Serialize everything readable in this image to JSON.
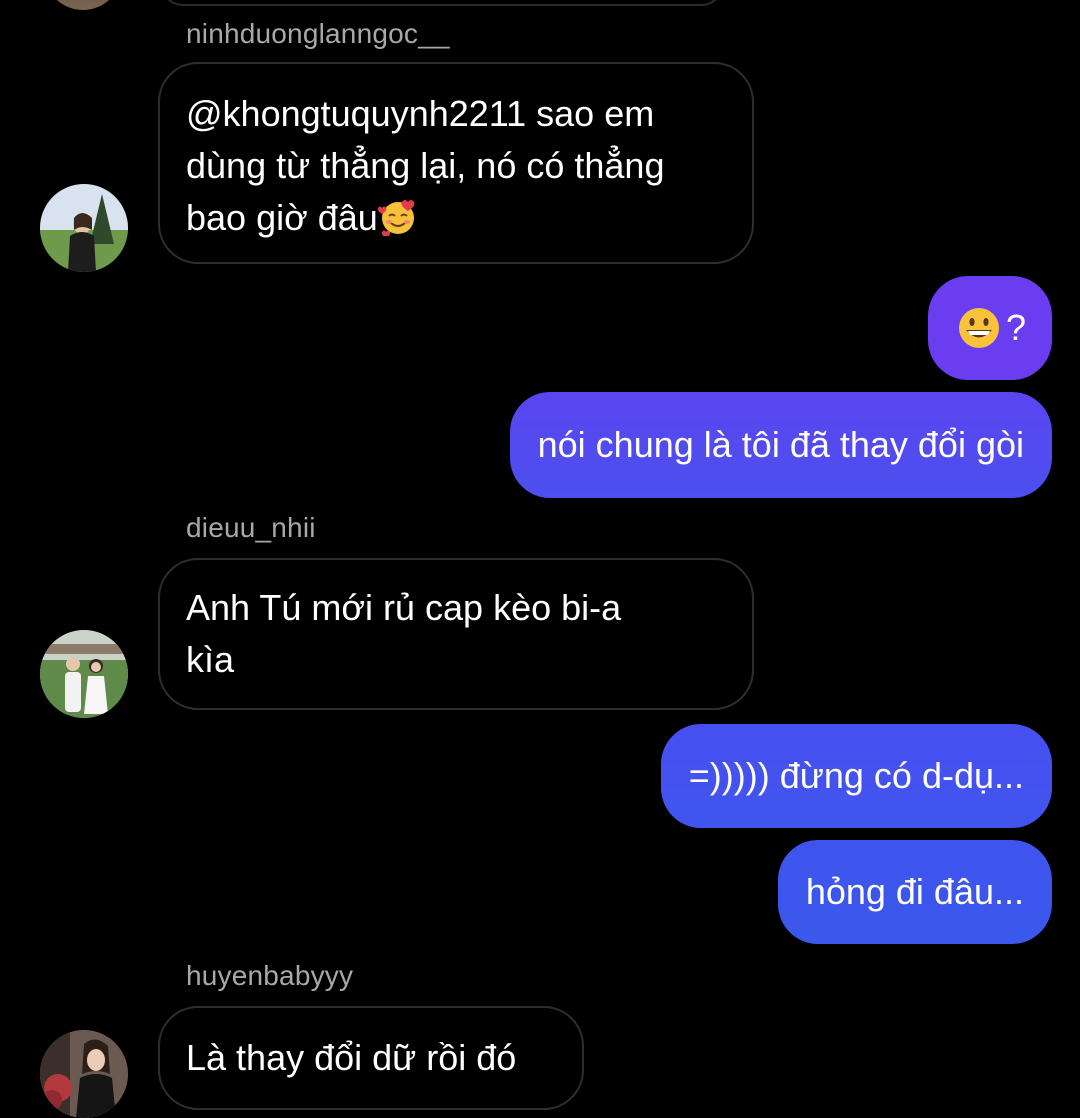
{
  "messages": [
    {
      "sender": "ninhduonglanngoc__",
      "text_line1": "@khongtuquynh2211 sao em",
      "text_line2": "dùng từ thẳng lại, nó có thẳng",
      "text_line3": "bao giờ đâu",
      "trailing_emoji": "smiling-face-with-hearts"
    },
    {
      "outgoing": true,
      "emoji": "grinning-face",
      "text": "?"
    },
    {
      "outgoing": true,
      "text": "nói chung là tôi đã thay đổi gòi"
    },
    {
      "sender": "dieuu_nhii",
      "text_line1": "Anh Tú mới rủ cap kèo bi-a",
      "text_line2": "kìa"
    },
    {
      "outgoing": true,
      "text": "=))))) đừng có d-dụ..."
    },
    {
      "outgoing": true,
      "text": "hỏng đi đâu..."
    },
    {
      "sender": "huyenbabyyy",
      "text_line1": "Là thay đổi dữ rồi đó"
    }
  ],
  "colors": {
    "background": "#000000",
    "incoming_border": "#2e2e2e",
    "sender_text": "#a8a8a8",
    "outgoing_purple": "#6a3df0",
    "outgoing_blue": "#3f55ee"
  }
}
